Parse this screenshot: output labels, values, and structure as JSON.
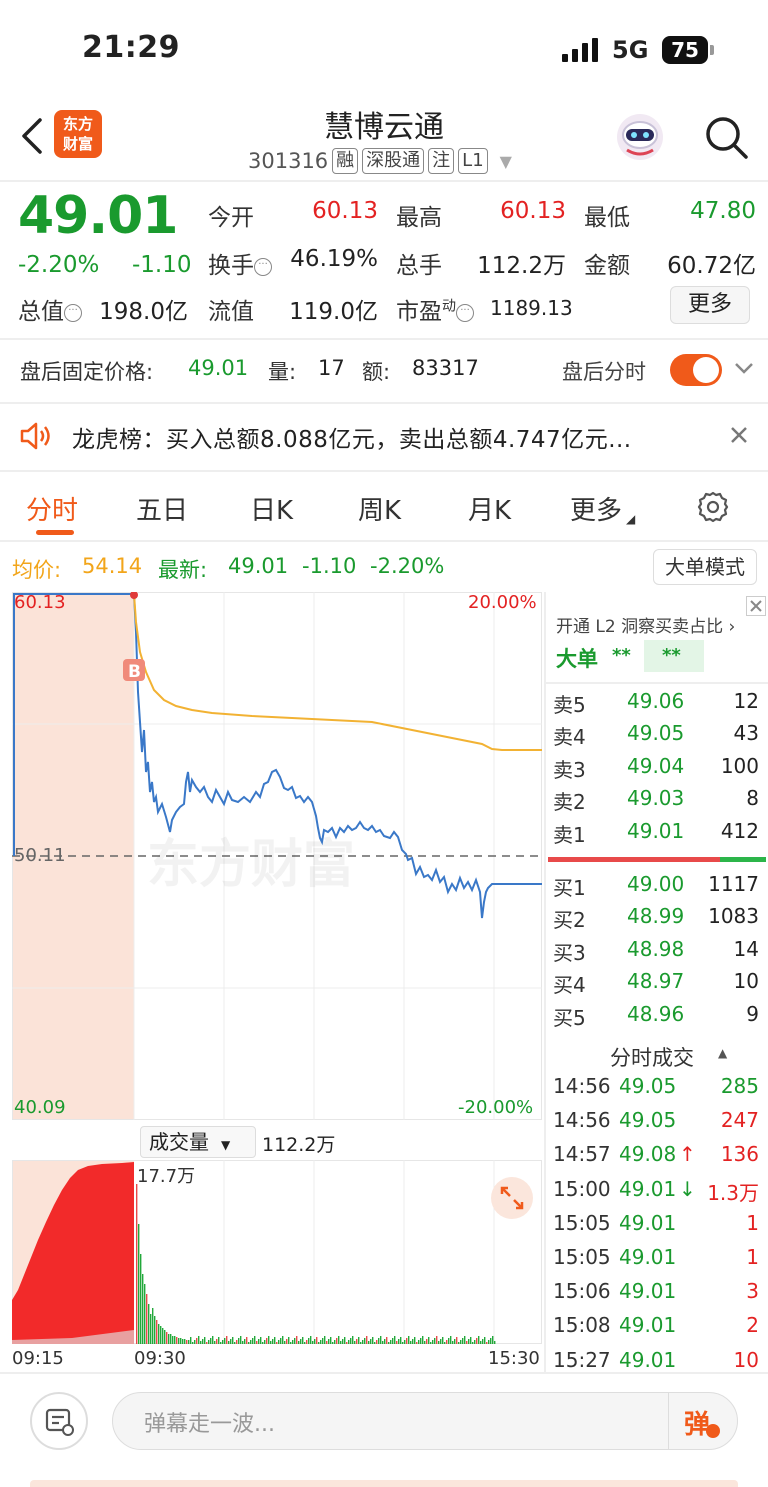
{
  "status": {
    "time": "21:29",
    "network": "5G",
    "battery": "75"
  },
  "header": {
    "name": "慧博云通",
    "code": "301316",
    "tags": [
      "融",
      "深股通",
      "注",
      "L1"
    ],
    "logo_text": "东方财富"
  },
  "quote": {
    "price": "49.01",
    "pct": "-2.20%",
    "chg": "-1.10",
    "open_label": "今开",
    "open": "60.13",
    "high_label": "最高",
    "high": "60.13",
    "low_label": "最低",
    "low": "47.80",
    "turnover_label": "换手",
    "turnover": "46.19%",
    "vol_label": "总手",
    "vol": "112.2万",
    "amount_label": "金额",
    "amount": "60.72亿",
    "mcap_label": "总值",
    "mcap": "198.0亿",
    "float_label": "流值",
    "float": "119.0亿",
    "pe_label": "市盈",
    "pe_sup": "动",
    "pe": "1189.13",
    "more": "更多"
  },
  "after_hours": {
    "label": "盘后固定价格:",
    "price": "49.01",
    "vol_label": "量:",
    "vol": "17",
    "amt_label": "额:",
    "amt": "83317",
    "toggle_label": "盘后分时"
  },
  "dragon_tiger": {
    "text": "龙虎榜：买入总额8.088亿元，卖出总额4.747亿元..."
  },
  "tabs": [
    "分时",
    "五日",
    "日K",
    "周K",
    "月K",
    "更多"
  ],
  "chart_header": {
    "avg_label": "均价:",
    "avg": "54.14",
    "latest_label": "最新:",
    "latest": "49.01",
    "latest_chg": "-1.10",
    "latest_pct": "-2.20%",
    "big_order_btn": "大单模式"
  },
  "chart_data": {
    "type": "line",
    "price_axis": {
      "top": "60.13",
      "mid": "50.11",
      "bottom": "40.09",
      "top_pct": "20.00%",
      "bottom_pct": "-20.00%"
    },
    "marker": "B",
    "watermark": "东方财富",
    "volume_label": "成交量",
    "volume_total": "112.2万",
    "volume_peak": "17.7万",
    "x_labels": [
      "09:15",
      "09:30",
      "15:30"
    ]
  },
  "order_book": {
    "l2_text": "开通 L2 洞察买卖占比",
    "big_order_label": "大单",
    "big_order_vals": [
      "**",
      "**"
    ],
    "asks": [
      {
        "label": "卖5",
        "price": "49.06",
        "qty": "12"
      },
      {
        "label": "卖4",
        "price": "49.05",
        "qty": "43"
      },
      {
        "label": "卖3",
        "price": "49.04",
        "qty": "100"
      },
      {
        "label": "卖2",
        "price": "49.03",
        "qty": "8"
      },
      {
        "label": "卖1",
        "price": "49.01",
        "qty": "412"
      }
    ],
    "bids": [
      {
        "label": "买1",
        "price": "49.00",
        "qty": "1117"
      },
      {
        "label": "买2",
        "price": "48.99",
        "qty": "1083"
      },
      {
        "label": "买3",
        "price": "48.98",
        "qty": "14"
      },
      {
        "label": "买4",
        "price": "48.97",
        "qty": "10"
      },
      {
        "label": "买5",
        "price": "48.96",
        "qty": "9"
      }
    ]
  },
  "trades": {
    "title": "分时成交",
    "rows": [
      {
        "time": "14:56",
        "price": "49.05",
        "dir": "",
        "qty": "285",
        "qty_color": "green"
      },
      {
        "time": "14:56",
        "price": "49.05",
        "dir": "",
        "qty": "247",
        "qty_color": "red"
      },
      {
        "time": "14:57",
        "price": "49.08",
        "dir": "↑",
        "qty": "136",
        "qty_color": "red"
      },
      {
        "time": "15:00",
        "price": "49.01",
        "dir": "↓",
        "qty": "1.3万",
        "qty_color": "red"
      },
      {
        "time": "15:05",
        "price": "49.01",
        "dir": "",
        "qty": "1",
        "qty_color": "red"
      },
      {
        "time": "15:05",
        "price": "49.01",
        "dir": "",
        "qty": "1",
        "qty_color": "red"
      },
      {
        "time": "15:06",
        "price": "49.01",
        "dir": "",
        "qty": "3",
        "qty_color": "red"
      },
      {
        "time": "15:08",
        "price": "49.01",
        "dir": "",
        "qty": "2",
        "qty_color": "red"
      },
      {
        "time": "15:27",
        "price": "49.01",
        "dir": "",
        "qty": "10",
        "qty_color": "red"
      }
    ]
  },
  "bottom": {
    "placeholder": "弹幕走一波...",
    "send": "弹"
  },
  "colors": {
    "accent": "#f05a1a",
    "up": "#e32222",
    "down": "#1a9a2e",
    "price_line": "#3a78c8",
    "avg_line": "#f2b233"
  }
}
